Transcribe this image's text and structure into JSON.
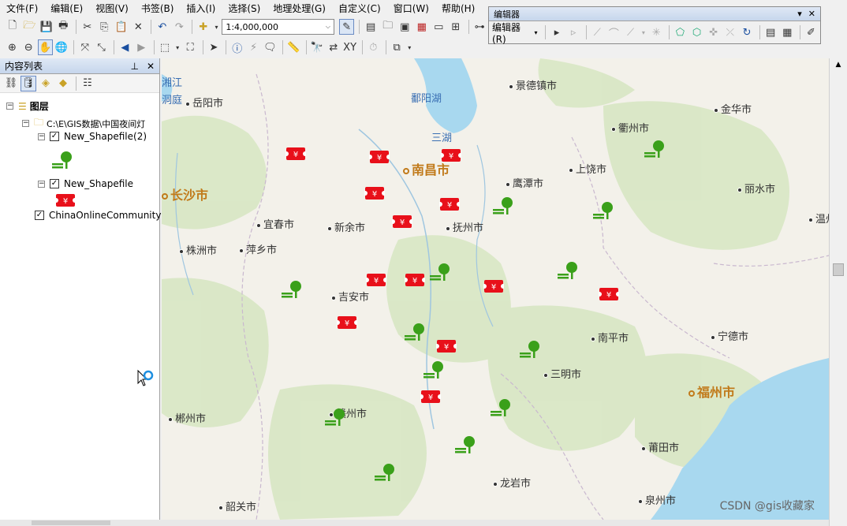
{
  "menu": [
    "文件(F)",
    "编辑(E)",
    "视图(V)",
    "书签(B)",
    "插入(I)",
    "选择(S)",
    "地理处理(G)",
    "自定义(C)",
    "窗口(W)",
    "帮助(H)"
  ],
  "toolbar": {
    "scale_value": "1:4,000,000"
  },
  "editor": {
    "title": "编辑器",
    "menu_label": "编辑器(R)"
  },
  "toc": {
    "title": "内容列表",
    "root_label": "图层",
    "folder_label": "C:\\E\\GIS数据\\中国夜间灯",
    "layers": [
      {
        "name": "New_Shapefile(2)",
        "checked": true,
        "symbol": "park-bench-tree-icon"
      },
      {
        "name": "New_Shapefile",
        "checked": true,
        "symbol": "ticket-icon"
      },
      {
        "name": "ChinaOnlineCommunity",
        "checked": true
      }
    ]
  },
  "map": {
    "capitals": [
      "南昌市",
      "长沙市",
      "福州市"
    ],
    "cities": [
      "景德镇市",
      "金华市",
      "衢州市",
      "岳阳市",
      "上饶市",
      "丽水市",
      "鹰潭市",
      "宜春市",
      "新余市",
      "抚州市",
      "株洲市",
      "萍乡市",
      "温州",
      "吉安市",
      "宁德市",
      "南平市",
      "三明市",
      "赣州市",
      "郴州市",
      "莆田市",
      "龙岩市",
      "泉州市",
      "韶关市"
    ],
    "water": [
      "湘江",
      "鄱阳湖",
      "三湖",
      "洞庭"
    ],
    "colors": {
      "ticket": "#e8101a",
      "tree": "#3aa01a",
      "capital": "#c17a1a",
      "water": "#a8d8ef",
      "land": "#f3f1ea"
    }
  },
  "watermark": "CSDN @gis收藏家"
}
